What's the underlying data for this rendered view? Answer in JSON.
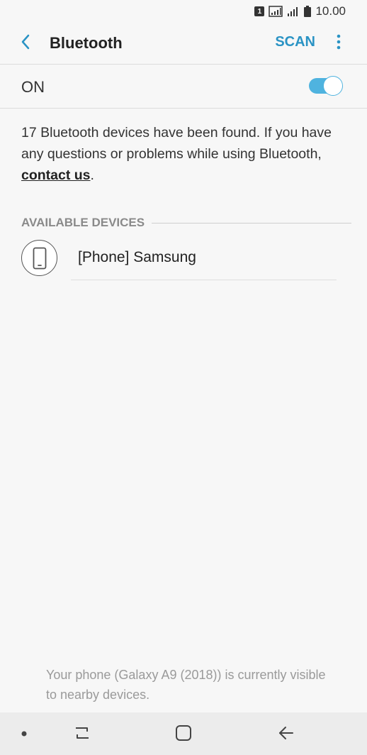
{
  "status_bar": {
    "sim_label": "1",
    "time": "10.00"
  },
  "app_bar": {
    "title": "Bluetooth",
    "scan_label": "SCAN",
    "back_icon": "chevron-left-icon",
    "more_icon": "more-vertical-icon"
  },
  "toggle_row": {
    "label": "ON",
    "state": "on"
  },
  "info": {
    "text": "17 Bluetooth devices have been found. If you have any questions or problems while using Bluetooth, ",
    "link": "contact us",
    "suffix": "."
  },
  "available": {
    "header": "AVAILABLE DEVICES",
    "devices": [
      {
        "name": "[Phone] Samsung",
        "icon": "phone-icon"
      }
    ]
  },
  "footer_note": "Your phone (Galaxy A9 (2018)) is currently visible to nearby devices.",
  "colors": {
    "accent": "#2a93c4",
    "toggle": "#4fb3df",
    "background": "#f7f7f7"
  }
}
